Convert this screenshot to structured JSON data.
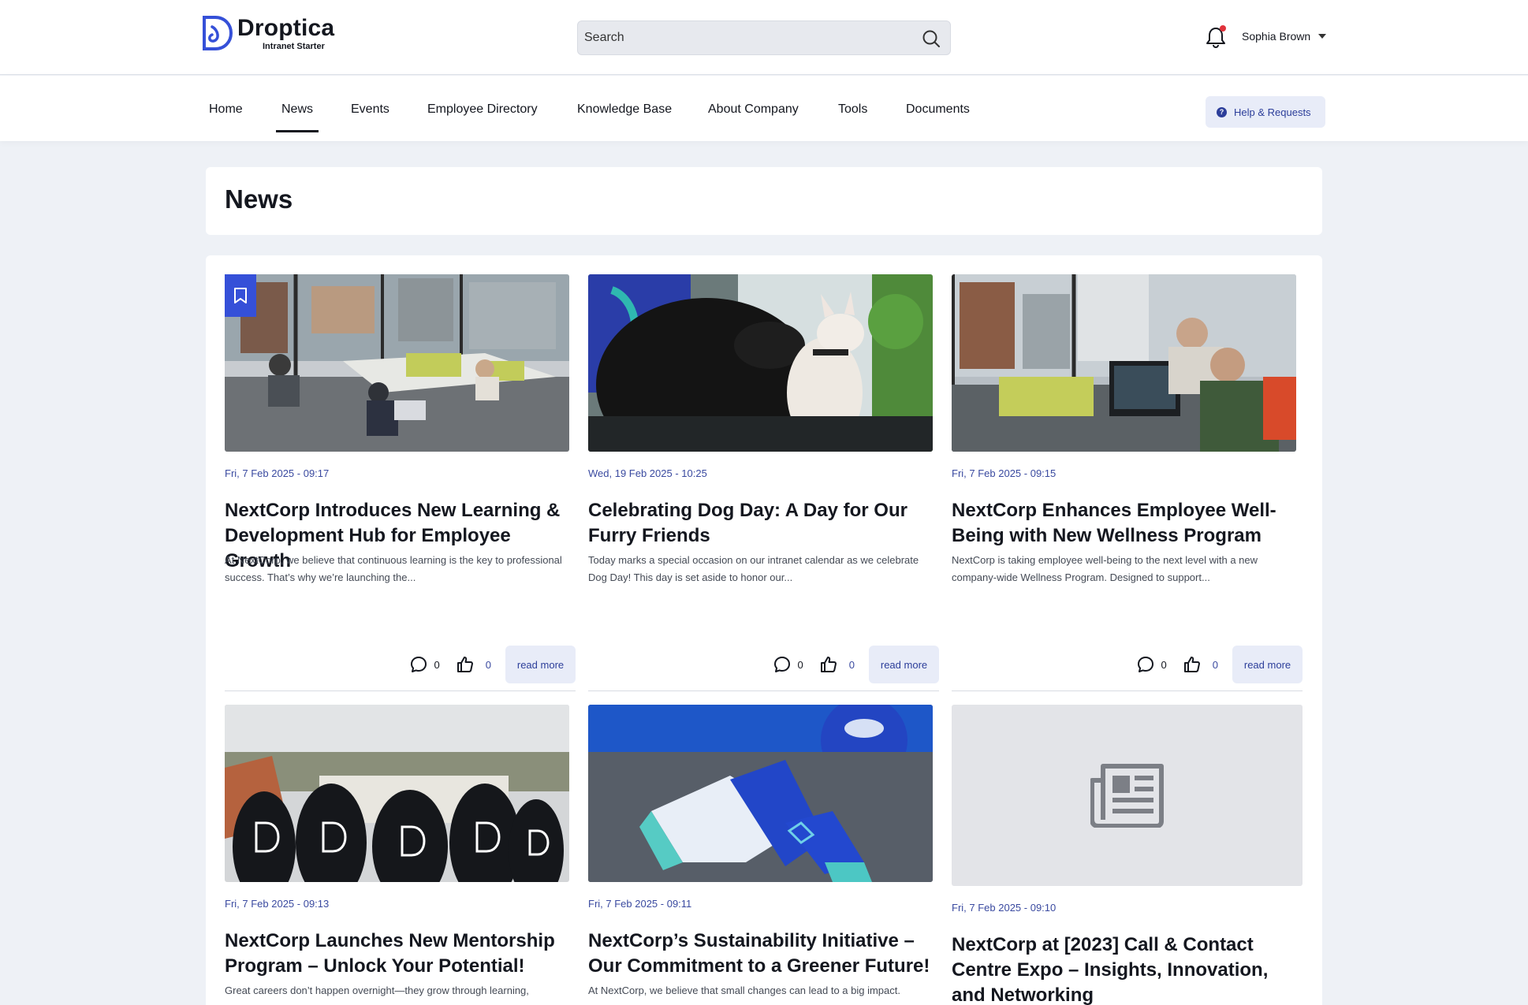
{
  "brand": {
    "name": "Droptica",
    "subtitle": "Intranet Starter",
    "accent": "#3550d8"
  },
  "search": {
    "placeholder": "Search"
  },
  "user": {
    "name": "Sophia Brown"
  },
  "nav": {
    "items": [
      "Home",
      "News",
      "Events",
      "Employee Directory",
      "Knowledge Base",
      "About Company",
      "Tools",
      "Documents"
    ],
    "active": "News",
    "help_label": "Help & Requests"
  },
  "page": {
    "title": "News"
  },
  "news": [
    {
      "date": "Fri, 7 Feb 2025 - 09:17",
      "title": "NextCorp Introduces New Learning & Development Hub for Employee Growth",
      "summary": "At NextCorp, we believe that continuous learning is the key to professional success. That’s why we’re launching the...",
      "comments": "0",
      "likes": "0",
      "read_more": "read more",
      "image": "office-workspace-photo",
      "bookmarked": true
    },
    {
      "date": "Wed, 19 Feb 2025 - 10:25",
      "title": "Celebrating Dog Day: A Day for Our Furry Friends",
      "summary": "Today marks a special occasion on our intranet calendar as we celebrate Dog Day! This day is set aside to honor our...",
      "comments": "0",
      "likes": "0",
      "read_more": "read more",
      "image": "office-dogs-photo"
    },
    {
      "date": "Fri, 7 Feb 2025 - 09:15",
      "title": "NextCorp Enhances Employee Well-Being with New Wellness Program",
      "summary": "NextCorp is taking employee well-being to the next level with a new company-wide Wellness Program. Designed to support...",
      "comments": "0",
      "likes": "0",
      "read_more": "read more",
      "image": "colleagues-at-desk-photo"
    },
    {
      "date": "Fri, 7 Feb 2025 - 09:13",
      "title": "NextCorp Launches New Mentorship Program – Unlock Your Potential!",
      "summary": "Great careers don’t happen overnight—they grow through learning,",
      "image": "team-hoodies-photo"
    },
    {
      "date": "Fri, 7 Feb 2025 - 09:11",
      "title": "NextCorp’s Sustainability Initiative – Our Commitment to a Greener Future!",
      "summary": "At NextCorp, we believe that small changes can lead to a big impact.",
      "image": "branded-socks-photo"
    },
    {
      "date": "Fri, 7 Feb 2025 - 09:10",
      "title": "NextCorp at [2023] Call & Contact Centre Expo – Insights, Innovation, and Networking",
      "summary": "",
      "image": "newspaper-placeholder-icon"
    }
  ]
}
